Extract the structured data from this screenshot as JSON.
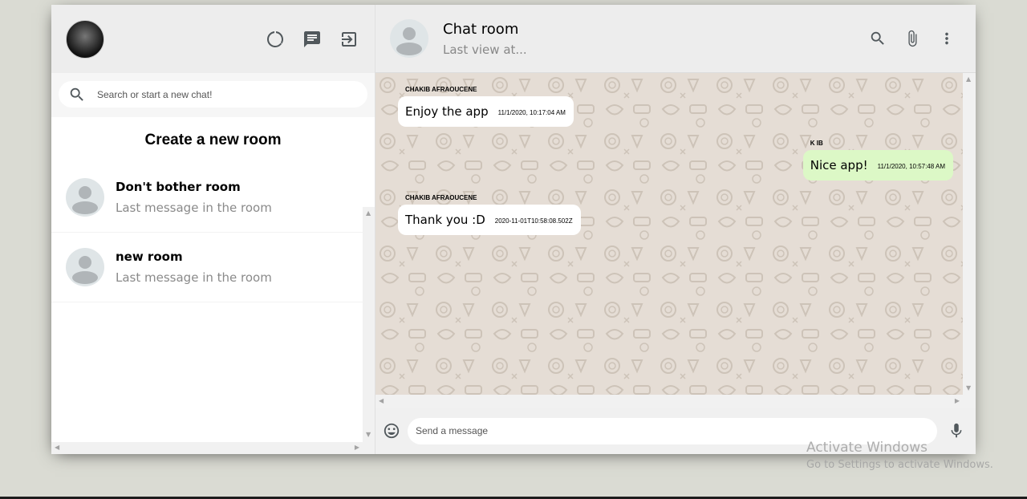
{
  "sidebar": {
    "search_placeholder": "Search or start a new chat!",
    "new_room_label": "Create a new room",
    "rooms": [
      {
        "name": "Don't bother room",
        "last_message": "Last message in the room"
      },
      {
        "name": "new room",
        "last_message": "Last message in the room"
      }
    ]
  },
  "chat": {
    "title": "Chat room",
    "subtitle": "Last view at...",
    "messages": [
      {
        "sender": "CHAKIB AFRAOUCENE",
        "text": "Enjoy the app",
        "time": "11/1/2020, 10:17:04 AM",
        "own": false
      },
      {
        "sender": "K IB",
        "text": "Nice app!",
        "time": "11/1/2020, 10:57:48 AM",
        "own": true
      },
      {
        "sender": "CHAKIB AFRAOUCENE",
        "text": "Thank you :D",
        "time": "2020-11-01T10:58:08.502Z",
        "own": false
      }
    ],
    "input_placeholder": "Send a message"
  },
  "watermark": {
    "title": "Activate Windows",
    "subtitle": "Go to Settings to activate Windows."
  },
  "colors": {
    "own_bubble": "#dcf8c6",
    "other_bubble": "#ffffff",
    "chat_background": "#e5ddd5",
    "header_background": "#ededed"
  },
  "icons": [
    "status-icon",
    "new-chat-icon",
    "logout-icon",
    "search-icon",
    "attach-icon",
    "more-vert-icon",
    "emoji-icon",
    "mic-icon"
  ]
}
